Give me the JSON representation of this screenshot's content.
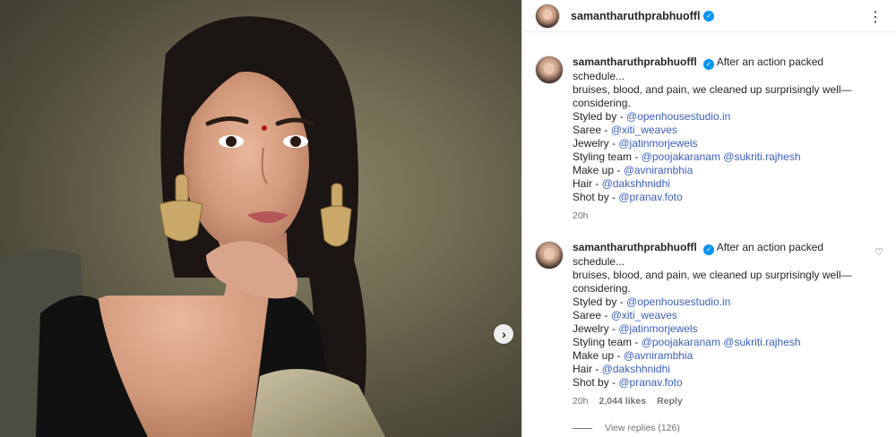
{
  "post": {
    "username": "samantharuthprabhuoffl",
    "more_icon": "more-horizontal-icon"
  },
  "comments": [
    {
      "username": "samantharuthprabhuoffl",
      "lines": [
        "After an action packed schedule...",
        "bruises, blood, and pain, we cleaned up surprisingly well—",
        "considering."
      ],
      "credits": [
        {
          "label": "Styled by - ",
          "mentions": [
            "@openhousestudio.in"
          ]
        },
        {
          "label": "Saree - ",
          "mentions": [
            "@xiti_weaves"
          ]
        },
        {
          "label": "Jewelry - ",
          "mentions": [
            "@jatinmorjewels"
          ]
        },
        {
          "label": "Styling team - ",
          "mentions": [
            "@poojakaranam",
            "@sukriti.rajhesh"
          ]
        },
        {
          "label": "Make up - ",
          "mentions": [
            "@avnirambhia"
          ]
        },
        {
          "label": "Hair - ",
          "mentions": [
            "@dakshhnidhi"
          ]
        },
        {
          "label": "Shot by - ",
          "mentions": [
            "@pranav.foto"
          ]
        }
      ],
      "time": "20h"
    },
    {
      "username": "samantharuthprabhuoffl",
      "lines": [
        "After an action packed schedule...",
        "bruises, blood, and pain, we cleaned up surprisingly well—",
        "considering."
      ],
      "credits": [
        {
          "label": "Styled by - ",
          "mentions": [
            "@openhousestudio.in"
          ]
        },
        {
          "label": "Saree - ",
          "mentions": [
            "@xiti_weaves"
          ]
        },
        {
          "label": "Jewelry - ",
          "mentions": [
            "@jatinmorjewels"
          ]
        },
        {
          "label": "Styling team - ",
          "mentions": [
            "@poojakaranam",
            "@sukriti.rajhesh"
          ]
        },
        {
          "label": "Make up - ",
          "mentions": [
            "@avnirambhia"
          ]
        },
        {
          "label": "Hair - ",
          "mentions": [
            "@dakshhnidhi"
          ]
        },
        {
          "label": "Shot by - ",
          "mentions": [
            "@pranav.foto"
          ]
        }
      ],
      "time": "20h",
      "likes": "2,044 likes",
      "reply_label": "Reply"
    }
  ],
  "view_replies": "View replies (126)",
  "colors": {
    "verified": "#0095f6",
    "mention": "#3b5fc4",
    "muted": "#737373"
  }
}
